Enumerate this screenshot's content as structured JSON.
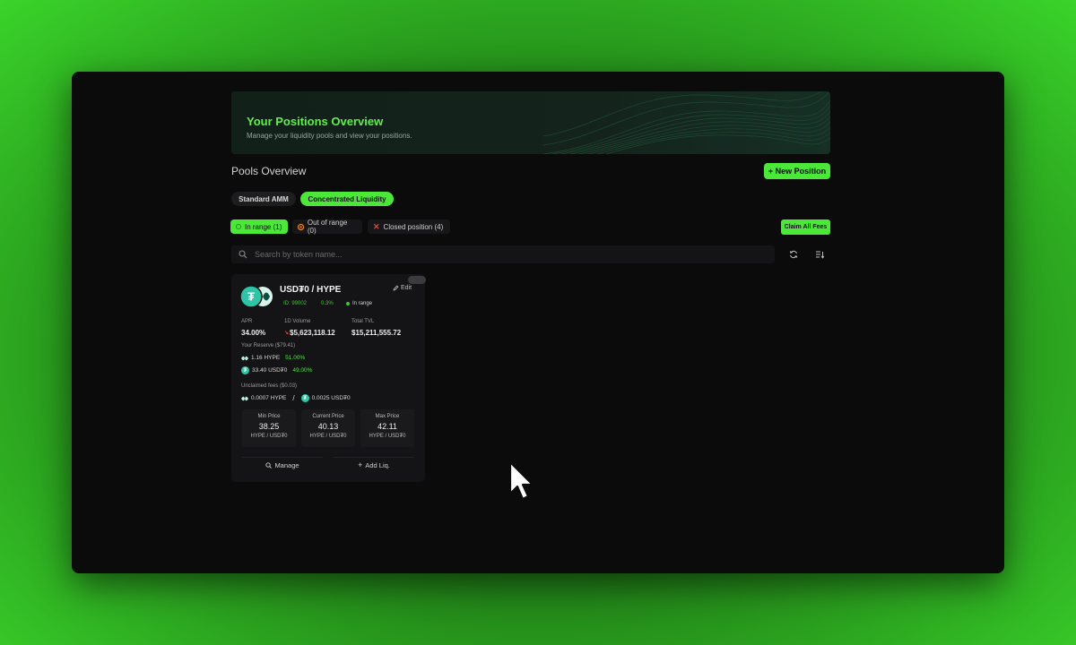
{
  "banner": {
    "title": "Your Positions Overview",
    "subtitle": "Manage your liquidity pools and view your positions."
  },
  "section_title": "Pools Overview",
  "new_position_label": "+ New Position",
  "tabs": [
    {
      "label": "Standard AMM",
      "active": false
    },
    {
      "label": "Concentrated Liquidity",
      "active": true
    }
  ],
  "filters": [
    {
      "label": "In range (1)",
      "active": true
    },
    {
      "label": "Out of range (0)",
      "active": false
    },
    {
      "label": "Closed position (4)",
      "active": false
    }
  ],
  "claim_all_label": "Claim All Fees",
  "search": {
    "placeholder": "Search by token name..."
  },
  "position": {
    "pair": "USD₮0 / HYPE",
    "edit_label": "Edit",
    "id": "ID: 99002",
    "fee": "0.3%",
    "status": "In range",
    "stats": [
      {
        "label": "APR",
        "value": "34.00%"
      },
      {
        "label": "1D Volume",
        "value": "$5,623,118.12"
      },
      {
        "label": "Total TVL",
        "value": "$15,211,555.72"
      }
    ],
    "reserve_label": "Your Reserve ($79.41)",
    "reserves": [
      {
        "token": "HYPE",
        "amount": "1.16 HYPE",
        "pct": "51.00%"
      },
      {
        "token": "USDT0",
        "amount": "33.40 USD₮0",
        "pct": "49.00%"
      }
    ],
    "fees_label": "Unclaimed fees ($0.03)",
    "fees": [
      {
        "token": "HYPE",
        "amount": "0.0007 HYPE"
      },
      {
        "token": "USDT0",
        "amount": "0.0025 USD₮0"
      }
    ],
    "fee_separator": "/",
    "prices": [
      {
        "label": "Min Price",
        "value": "38.25",
        "unit": "HYPE / USD₮0"
      },
      {
        "label": "Current Price",
        "value": "40.13",
        "unit": "HYPE / USD₮0"
      },
      {
        "label": "Max Price",
        "value": "42.11",
        "unit": "HYPE / USD₮0"
      }
    ],
    "manage_label": "Manage",
    "add_liq_label": "Add Liq."
  },
  "colors": {
    "accent": "#4be83a",
    "window_bg": "#0b0b0c",
    "card_bg": "#141416",
    "usdt_teal": "#2ec4a6"
  },
  "icons": [
    "search-icon",
    "refresh-icon",
    "sort-icon",
    "edit-icon",
    "magnifier-icon",
    "plus-icon",
    "hype-token-icon",
    "usdt0-token-icon",
    "close-x-icon",
    "cursor-icon"
  ]
}
